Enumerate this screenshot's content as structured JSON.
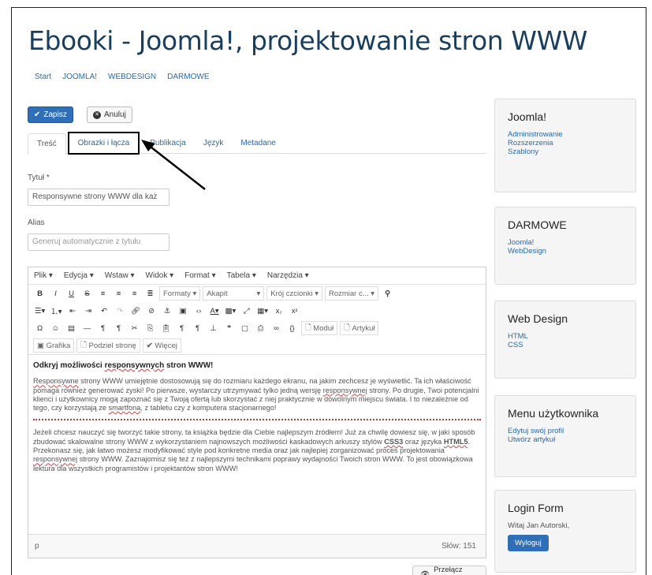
{
  "site": {
    "title": "Ebooki - Joomla!, projektowanie stron WWW",
    "nav": [
      "Start",
      "JOOMLA!",
      "WEBDESIGN",
      "DARMOWE"
    ]
  },
  "toolbar": {
    "save_label": "Zapisz",
    "cancel_label": "Anuluj"
  },
  "tabs": [
    {
      "label": "Treść"
    },
    {
      "label": "Obrazki i łącza"
    },
    {
      "label": "Publikacja"
    },
    {
      "label": "Język"
    },
    {
      "label": "Metadane"
    }
  ],
  "form": {
    "title_label": "Tytuł *",
    "title_value": "Responsywne strony WWW dla każ",
    "alias_label": "Alias",
    "alias_placeholder": "Generuj automatycznie z tytułu"
  },
  "editor": {
    "menus": [
      "Plik ▾",
      "Edycja ▾",
      "Wstaw ▾",
      "Widok ▾",
      "Format ▾",
      "Tabela ▾",
      "Narzędzia ▾"
    ],
    "formats_label": "Formaty ▾",
    "paragraph_label": "Akapit",
    "font_label": "Krój czcionki ▾",
    "size_label": "Rozmiar c... ▾",
    "module_label": "Moduł",
    "article_label": "Artykuł",
    "image_label": "Grafika",
    "pagebreak_label": "Podziel stronę",
    "more_label": "Więcej",
    "heading": {
      "pre": "Odkryj możliwości ",
      "squiggle": "responsywnych",
      "post": " stron WWW!"
    },
    "para1": {
      "squiggle1": "Responsywne",
      "t1": " strony WWW umiejętnie dostosowują się do rozmiaru każdego ekranu, na jakim zechcesz je wyświetlić. Ta ich właściwość pomaga również generować zyski! Po pierwsze, wystarczy utrzymywać tylko jedną wersję ",
      "squiggle2": "responsywnej",
      "t2": " strony. Po drugie, Twoi potencjalni klienci i użytkownicy mogą zapoznać się z Twoją ofertą lub skorzystać z niej praktycznie w dowolnym miejscu świata. I to niezależnie od tego, czy korzystają ze ",
      "squiggle3": "smartfona",
      "t3": ", z tabletu czy z komputera stacjonarnego!"
    },
    "para2": {
      "t1": "Jeżeli chcesz nauczyć się tworzyć takie strony, ta książka będzie dla Ciebie najlepszym źródłem! Już za chwilę dowiesz się, w jaki sposób zbudować skalowalne strony WWW z wykorzystaniem najnowszych możliwości kaskadowych arkuszy stylów ",
      "b1": "CSS3",
      "t2": " oraz języka ",
      "b2": "HTML5",
      "t3": ". Przekonasz się, jak łatwo możesz modyfikować style pod konkretne media oraz jak najlepiej zorganizować proces projektowania ",
      "squiggle": "responsywnej",
      "t4": " strony WWW. Zaznajomisz się też z najlepszymi technikami poprawy wydajności Twoich stron WWW. To jest obowiązkowa lektura dla wszystkich programistów i projektantów stron WWW!"
    },
    "path": "p",
    "word_count": "Słów: 151"
  },
  "toggle_editor_label": "Przełącz edytor",
  "sidebar": {
    "joomla": {
      "title": "Joomla!",
      "links": [
        "Administrowanie",
        "Rozszerzenia",
        "Szablony"
      ]
    },
    "darmowe": {
      "title": "DARMOWE",
      "links": [
        "Joomla!",
        "WebDesign"
      ]
    },
    "webdesign": {
      "title": "Web Design",
      "links": [
        "HTML",
        "CSS"
      ]
    },
    "usermenu": {
      "title": "Menu użytkownika",
      "links": [
        "Edytuj swój profil",
        "Utwórz artykuł"
      ]
    },
    "login": {
      "title": "Login Form",
      "greeting": "Witaj Jan Autorski,",
      "logout_label": "Wyloguj"
    }
  }
}
